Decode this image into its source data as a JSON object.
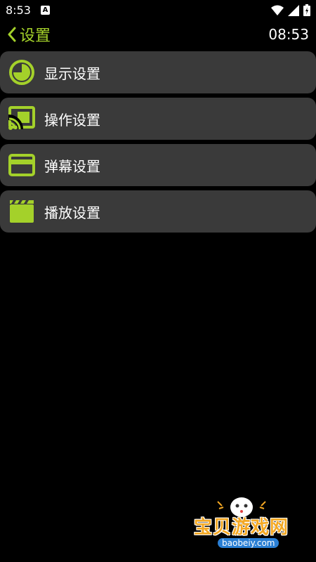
{
  "status_bar": {
    "time": "8:53",
    "notification_icon": "A"
  },
  "header": {
    "back_icon": "chevron-left-icon",
    "title": "设置",
    "clock": "08:53"
  },
  "menu": {
    "items": [
      {
        "label": "显示设置",
        "icon": "clock-icon"
      },
      {
        "label": "操作设置",
        "icon": "cast-icon"
      },
      {
        "label": "弹幕设置",
        "icon": "card-icon"
      },
      {
        "label": "播放设置",
        "icon": "clapperboard-icon"
      }
    ]
  },
  "watermark": {
    "title": "宝贝游戏网",
    "url": "baobeiy.com"
  },
  "colors": {
    "accent": "#a4d12a",
    "item_background": "#3a3a3a",
    "background": "#000000"
  }
}
